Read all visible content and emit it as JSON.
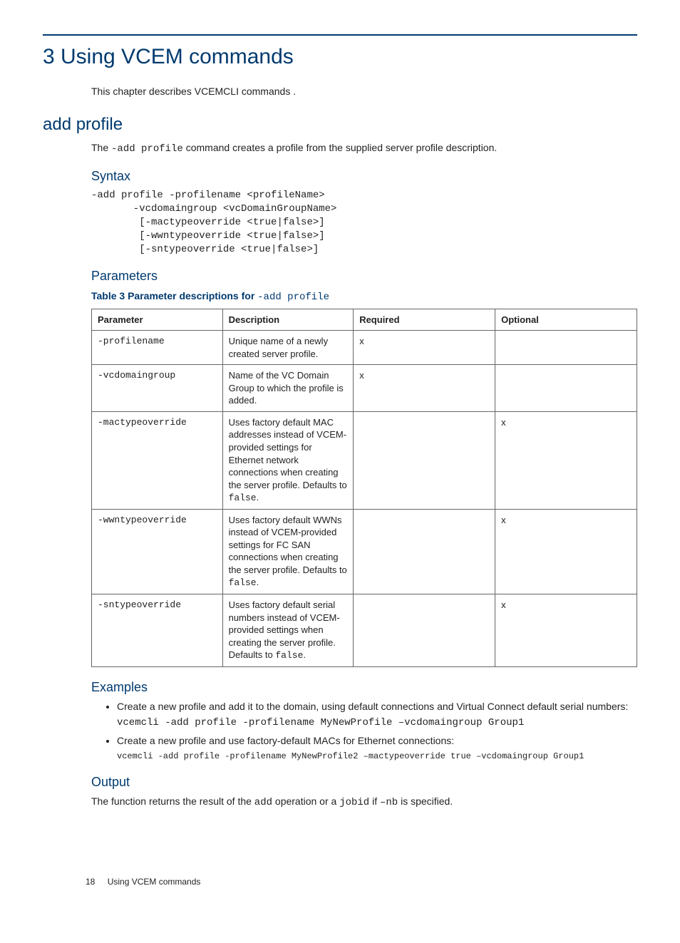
{
  "chapter": {
    "title": "3 Using VCEM commands",
    "intro": "This chapter describes VCEMCLI commands ."
  },
  "addProfile": {
    "heading": "add profile",
    "intro_pre": "The ",
    "intro_code": "-add profile",
    "intro_post": " command creates a profile from the supplied server profile description.",
    "syntax": {
      "heading": "Syntax",
      "code": "-add profile -profilename <profileName>\n       -vcdomaingroup <vcDomainGroupName>\n        [-mactypeoverride <true|false>]\n        [-wwntypeoverride <true|false>]\n        [-sntypeoverride <true|false>]"
    },
    "parameters": {
      "heading": "Parameters",
      "tableCaption_pre": "Table 3 Parameter descriptions for ",
      "tableCaption_code": "-add profile",
      "headers": {
        "parameter": "Parameter",
        "description": "Description",
        "required": "Required",
        "optional": "Optional"
      },
      "rows": [
        {
          "param": "-profilename",
          "desc_text": "Unique name of a newly created server profile.",
          "desc_code": "",
          "required": "x",
          "optional": ""
        },
        {
          "param": "-vcdomaingroup",
          "desc_text": "Name of the VC Domain Group to which the profile is added.",
          "desc_code": "",
          "required": "x",
          "optional": ""
        },
        {
          "param": "-mactypeoverride",
          "desc_text": "Uses factory default MAC addresses instead of VCEM-provided settings for Ethernet network connections when creating the server profile. Defaults to ",
          "desc_code": "false",
          "desc_post": ".",
          "required": "",
          "optional": "x"
        },
        {
          "param": "-wwntypeoverride",
          "desc_text": "Uses factory default WWNs instead of VCEM-provided settings for FC SAN connections when creating the server profile. Defaults to ",
          "desc_code": "false",
          "desc_post": ".",
          "required": "",
          "optional": "x"
        },
        {
          "param": "-sntypeoverride",
          "desc_text": "Uses factory default serial numbers instead of VCEM-provided settings when creating the server profile. Defaults to ",
          "desc_code": "false",
          "desc_post": ".",
          "required": "",
          "optional": "x"
        }
      ]
    },
    "examples": {
      "heading": "Examples",
      "items": [
        {
          "text": "Create a new profile and add it to the domain, using default connections and Virtual Connect default serial numbers:",
          "code": "vcemcli -add profile -profilename MyNewProfile –vcdomaingroup Group1",
          "small": false
        },
        {
          "text": "Create a new profile and use factory-default MACs for Ethernet connections:",
          "code": "vcemcli -add profile -profilename MyNewProfile2 –mactypeoverride true –vcdomaingroup Group1",
          "small": true
        }
      ]
    },
    "output": {
      "heading": "Output",
      "seg": {
        "a": "The function returns the result of the ",
        "b": "add",
        "c": " operation or a ",
        "d": "jobid",
        "e": " if ",
        "f": "–nb",
        "g": " is specified."
      }
    }
  },
  "footer": {
    "page": "18",
    "label": "Using VCEM commands"
  }
}
